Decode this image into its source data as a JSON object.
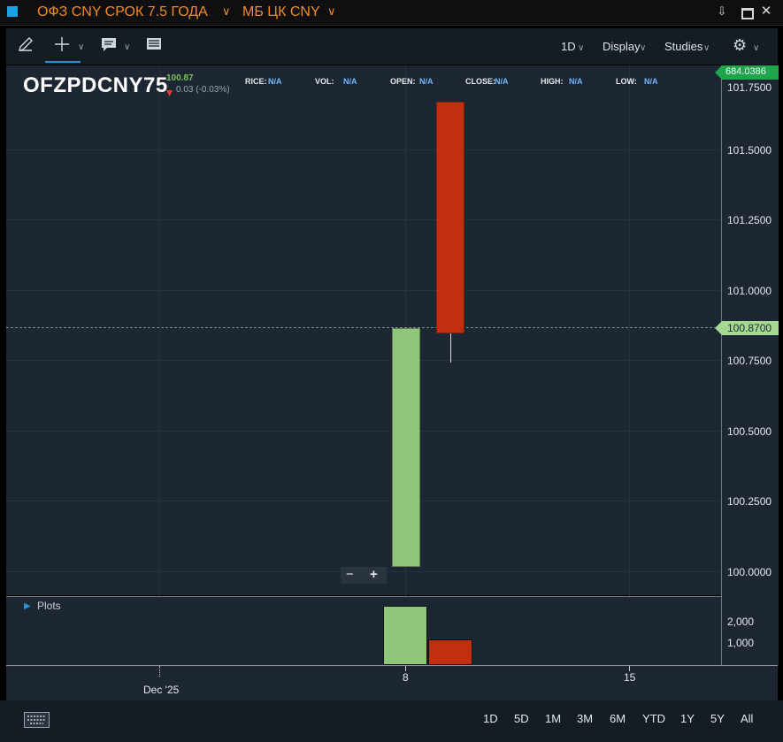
{
  "window": {
    "instrument_name": "ОФЗ CNY СРОК 7.5 ГОДА",
    "exchange": "МБ ЦК CNY",
    "icons": [
      "download-icon",
      "minimize-icon",
      "close-icon"
    ],
    "accent_color": "#1aa2e6",
    "title_color": "#f08c1e"
  },
  "toolbar": {
    "tools": [
      "pencil-icon",
      "crosshair-icon",
      "comment-icon",
      "table-icon"
    ],
    "interval": "1D",
    "display": "Display",
    "studies": "Studies",
    "settings_icon": "gear-icon"
  },
  "quote": {
    "symbol": "OFZPDCNY75",
    "last": "100.87",
    "change": "0.03 (-0.03%)",
    "change_icon": "down-triangle-icon",
    "fields": [
      {
        "label": "RICE:",
        "value": "N/A"
      },
      {
        "label": "VOL:",
        "value": "N/A"
      },
      {
        "label": "OPEN:",
        "value": "N/A"
      },
      {
        "label": "CLOSE:",
        "value": "N/A"
      },
      {
        "label": "HIGH:",
        "value": "N/A"
      },
      {
        "label": "LOW:",
        "value": "N/A"
      }
    ]
  },
  "chart_data": {
    "type": "candlestick",
    "x_ticks": [
      "Dec '25",
      "8",
      "15"
    ],
    "y_ticks": [
      "101.5000",
      "101.2500",
      "101.0000",
      "100.7500",
      "100.5000",
      "100.2500",
      "100.0000"
    ],
    "ylim": [
      99.985,
      101.78
    ],
    "current_price_label": "100.8700",
    "top_price_label": "684.0386",
    "candles": [
      {
        "x": "8",
        "open": 100.0,
        "close": 100.89,
        "high": 100.89,
        "low": 100.0,
        "color": "#8fc77a"
      },
      {
        "x": "9",
        "open": 101.73,
        "close": 100.87,
        "high": 101.73,
        "low": 100.76,
        "color": "#c0300e"
      }
    ],
    "volume": {
      "label": "Plots",
      "ticks": [
        "2,000",
        "1,000"
      ],
      "bars": [
        {
          "x": "8",
          "value": 2800,
          "color": "#8fc77a"
        },
        {
          "x": "9",
          "value": 1200,
          "color": "#c0300e"
        }
      ]
    },
    "zoom_controls": [
      "−",
      "+"
    ],
    "grid": true
  },
  "footer": {
    "keyboard_icon": "keyboard-icon",
    "ranges": [
      "1D",
      "5D",
      "1M",
      "3M",
      "6M",
      "YTD",
      "1Y",
      "5Y",
      "All"
    ]
  }
}
